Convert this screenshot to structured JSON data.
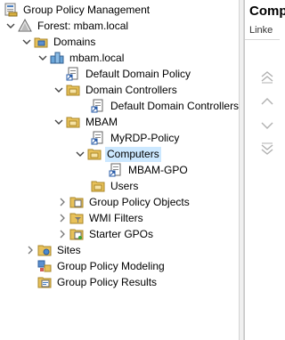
{
  "tree": {
    "root": "Group Policy Management",
    "forest": "Forest: mbam.local",
    "domains": "Domains",
    "domain": "mbam.local",
    "default_policy": "Default Domain Policy",
    "domain_controllers": "Domain Controllers",
    "default_dc_policy": "Default Domain Controllers",
    "mbam_ou": "MBAM",
    "rdp_policy": "MyRDP-Policy",
    "computers": "Computers",
    "mbam_gpo": "MBAM-GPO",
    "users": "Users",
    "gpo_container": "Group Policy Objects",
    "wmi_filters": "WMI Filters",
    "starter_gpos": "Starter GPOs",
    "sites": "Sites",
    "modeling": "Group Policy Modeling",
    "results": "Group Policy Results"
  },
  "right_pane": {
    "title": "Comp",
    "subtitle": "Linke"
  },
  "colors": {
    "selection": "#cce8ff",
    "folder": "#e8c15a",
    "arrow": "#444444"
  }
}
